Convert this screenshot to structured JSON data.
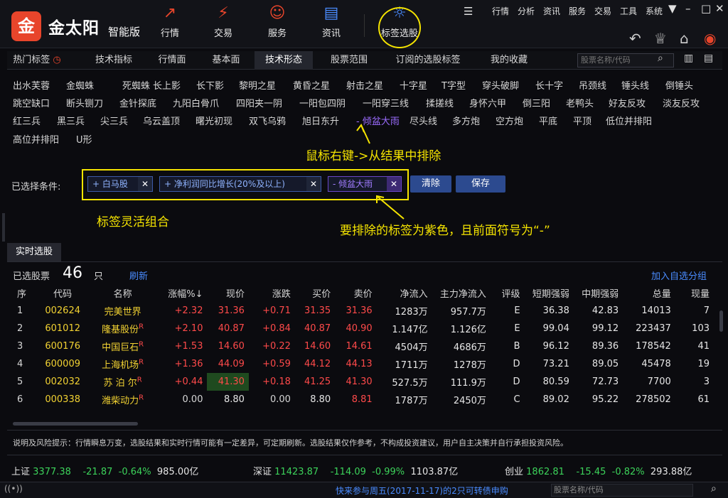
{
  "brand": {
    "logo": "金",
    "name": "金太阳",
    "sub": "智能版"
  },
  "topnav": [
    {
      "icon": "chart-line-icon",
      "glyph": "↗",
      "label": "行情"
    },
    {
      "icon": "trade-icon",
      "glyph": "⚡",
      "label": "交易"
    },
    {
      "icon": "user-icon",
      "glyph": "☺",
      "label": "服务"
    },
    {
      "icon": "news-icon",
      "glyph": "▤",
      "label": "资讯"
    },
    {
      "icon": "lightbulb-icon",
      "glyph": "☼",
      "label": "标签选股"
    }
  ],
  "menu": [
    "行情",
    "分析",
    "资讯",
    "服务",
    "交易",
    "工具",
    "系统"
  ],
  "tabs": [
    "热门标签",
    "技术指标",
    "行情面",
    "基本面",
    "技术形态",
    "股票范围",
    "订阅的选股标签",
    "我的收藏"
  ],
  "active_tab": "技术形态",
  "search_placeholder": "股票名称/代码",
  "tags": [
    [
      "出水芙蓉",
      "金蜘蛛",
      "死蜘蛛",
      "长上影",
      "长下影",
      "黎明之星",
      "黄昏之星",
      "射击之星",
      "十字星",
      "T字型",
      "穿头破脚",
      "长十字",
      "吊颈线",
      "锤头线",
      "倒锤头"
    ],
    [
      "跳空缺口",
      "断头铡刀",
      "金针探底",
      "九阳白骨爪",
      "四阳夹一阴",
      "一阳包四阴",
      "一阳穿三线",
      "揉搓线",
      "身怀六甲",
      "倒三阳",
      "老鸭头",
      "好友反攻",
      "淡友反攻"
    ],
    [
      "红三兵",
      "黑三兵",
      "尖三兵",
      "乌云盖顶",
      "曙光初现",
      "双飞乌鸦",
      "旭日东升",
      "- 倾盆大雨",
      "尽头线",
      "多方炮",
      "空方炮",
      "平底",
      "平顶",
      "低位并排阳"
    ],
    [
      "高位并排阳",
      "U形"
    ]
  ],
  "hints": {
    "right_click": "鼠标右键->从结果中排除",
    "combo": "标签灵活组合",
    "purple": "要排除的标签为紫色，且前面符号为“-”"
  },
  "conditions": {
    "label": "已选择条件:",
    "chips": [
      "+ 白马股",
      "+ 净利润同比增长(20%及以上)",
      "- 倾盆大雨"
    ],
    "clear": "清除",
    "save": "保存"
  },
  "realtime": {
    "tab": "实时选股",
    "count_label": "已选股票",
    "count": "46",
    "unit": "只",
    "refresh": "刷新",
    "add_group": "加入自选分组"
  },
  "table": {
    "headers": [
      "序",
      "代码",
      "名称",
      "涨幅%↓",
      "现价",
      "涨跌",
      "买价",
      "卖价",
      "净流入",
      "主力净流入",
      "评级",
      "短期强弱",
      "中期强弱",
      "总量",
      "现量"
    ],
    "rows": [
      [
        "1",
        "002624",
        "完美世界",
        "+2.32",
        "31.36",
        "+0.71",
        "31.35",
        "31.36",
        "1283万",
        "957.7万",
        "E",
        "36.38",
        "42.83",
        "14013",
        "7",
        ""
      ],
      [
        "2",
        "601012",
        "隆基股份",
        "+2.10",
        "40.87",
        "+0.84",
        "40.87",
        "40.90",
        "1.147亿",
        "1.126亿",
        "E",
        "99.04",
        "99.12",
        "223437",
        "103",
        "R"
      ],
      [
        "3",
        "600176",
        "中国巨石",
        "+1.53",
        "14.60",
        "+0.22",
        "14.60",
        "14.61",
        "4504万",
        "4686万",
        "B",
        "96.12",
        "89.36",
        "178542",
        "41",
        "R"
      ],
      [
        "4",
        "600009",
        "上海机场",
        "+1.36",
        "44.09",
        "+0.59",
        "44.12",
        "44.13",
        "1711万",
        "1278万",
        "D",
        "73.21",
        "89.05",
        "45478",
        "19",
        "R"
      ],
      [
        "5",
        "002032",
        "苏 泊 尔",
        "+0.44",
        "41.30",
        "+0.18",
        "41.25",
        "41.30",
        "527.5万",
        "111.9万",
        "D",
        "80.59",
        "72.73",
        "7700",
        "3",
        "R"
      ],
      [
        "6",
        "000338",
        "潍柴动力",
        "0.00",
        "8.80",
        "0.00",
        "8.80",
        "8.81",
        "1787万",
        "2450万",
        "C",
        "89.02",
        "95.22",
        "278502",
        "61",
        "R"
      ]
    ]
  },
  "notice": "说明及风险提示：行情瞬息万变，选股结果和实时行情可能有一定差异，可定期刷新。选股结果仅作参考，不构成投资建议，用户自主决策并自行承担投资风险。",
  "indices": [
    {
      "name": "上证",
      "value": "3377.38",
      "chg": "-21.87",
      "pct": "-0.64%",
      "amt": "985.00亿"
    },
    {
      "name": "深证",
      "value": "11423.87",
      "chg": "-114.09",
      "pct": "-0.99%",
      "amt": "1103.87亿"
    },
    {
      "name": "创业",
      "value": "1862.81",
      "chg": "-15.45",
      "pct": "-0.82%",
      "amt": "293.88亿"
    }
  ],
  "ticker": "快来参与周五(2017-11-17)的2只可转债申购",
  "status_search": "股票名称/代码",
  "colors": {
    "accent": "#e8452b",
    "highlight": "#f5e400",
    "exclude": "#9b6cff",
    "up": "#ff4a4a",
    "down": "#3cd25a",
    "code": "#f2d232"
  }
}
